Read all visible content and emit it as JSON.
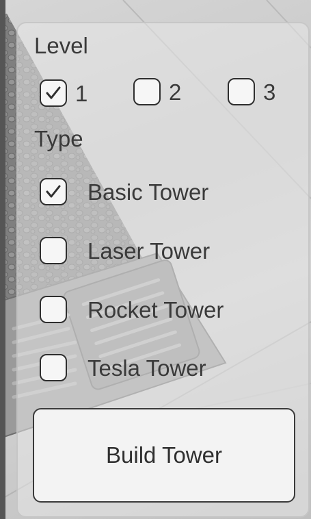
{
  "level": {
    "heading": "Level",
    "options": [
      {
        "label": "1",
        "checked": true
      },
      {
        "label": "2",
        "checked": false
      },
      {
        "label": "3",
        "checked": false
      }
    ]
  },
  "type": {
    "heading": "Type",
    "options": [
      {
        "label": "Basic Tower",
        "checked": true
      },
      {
        "label": "Laser Tower",
        "checked": false
      },
      {
        "label": "Rocket Tower",
        "checked": false
      },
      {
        "label": "Tesla Tower",
        "checked": false
      }
    ]
  },
  "build_button": {
    "label": "Build Tower"
  },
  "colors": {
    "panel": "#e8e8e8",
    "text": "#3a3a3a",
    "checkbox_border": "#2e2e2e"
  }
}
